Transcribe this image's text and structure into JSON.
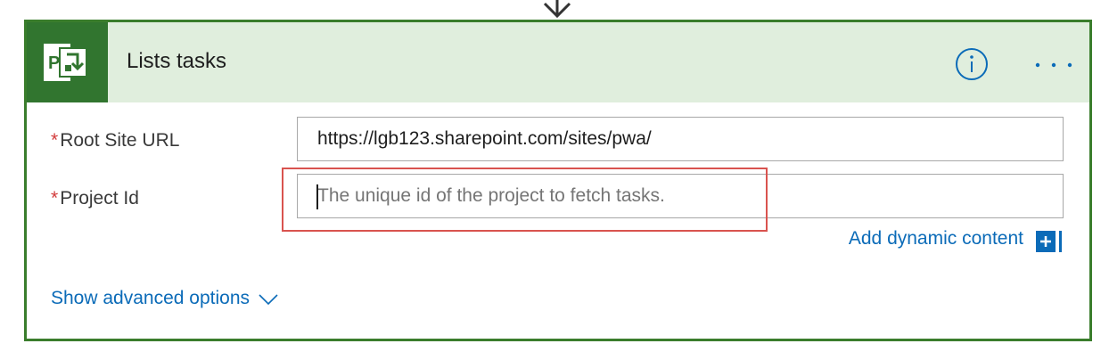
{
  "action": {
    "title": "Lists tasks",
    "app_icon": "project-icon",
    "info_icon": "info-icon",
    "more_icon": "more-icon"
  },
  "fields": {
    "root_site_url": {
      "required_mark": "*",
      "label": "Root Site URL",
      "value": "https://lgb123.sharepoint.com/sites/pwa/"
    },
    "project_id": {
      "required_mark": "*",
      "label": "Project Id",
      "value": "",
      "placeholder": "The unique id of the project to fetch tasks."
    }
  },
  "dynamic_content": {
    "label": "Add dynamic content",
    "icon": "plus-icon"
  },
  "advanced": {
    "label": "Show advanced options",
    "icon": "chevron-down-icon"
  },
  "colors": {
    "border": "#3a7d2c",
    "header_bg": "#e0eedd",
    "logo_bg": "#31752f",
    "link": "#0b6bb8",
    "required": "#d23a3a",
    "highlight": "#d9534f"
  }
}
